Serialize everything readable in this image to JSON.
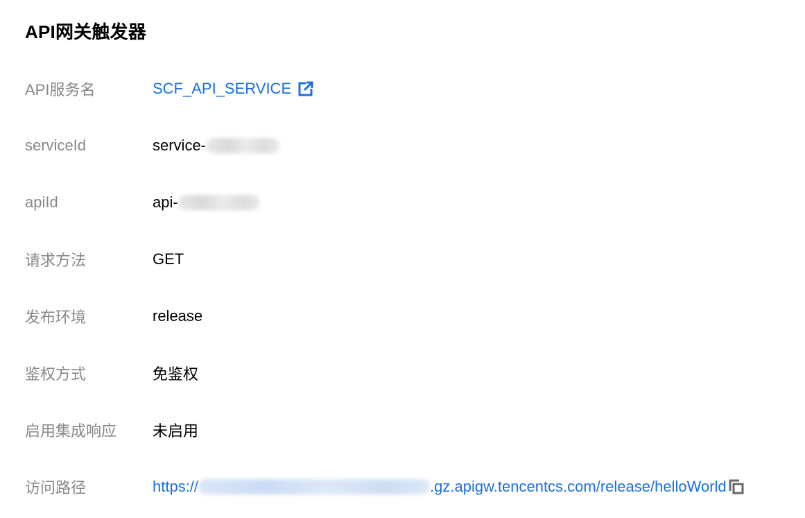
{
  "title": "API网关触发器",
  "colors": {
    "link": "#1a6fe0",
    "label": "#888888",
    "value": "#000000"
  },
  "rows": {
    "service_name": {
      "label": "API服务名",
      "value": "SCF_API_SERVICE",
      "icon": "external-link-icon"
    },
    "service_id": {
      "label": "serviceId",
      "value_prefix": "service-"
    },
    "api_id": {
      "label": "apiId",
      "value_prefix": "api-"
    },
    "method": {
      "label": "请求方法",
      "value": "GET"
    },
    "env": {
      "label": "发布环境",
      "value": "release"
    },
    "auth": {
      "label": "鉴权方式",
      "value": "免鉴权"
    },
    "integration": {
      "label": "启用集成响应",
      "value": "未启用"
    },
    "path": {
      "label": "访问路径",
      "value_prefix": "https://",
      "value_suffix": ".gz.apigw.tencentcs.com/release/helloWorld",
      "icon": "copy-icon"
    }
  }
}
